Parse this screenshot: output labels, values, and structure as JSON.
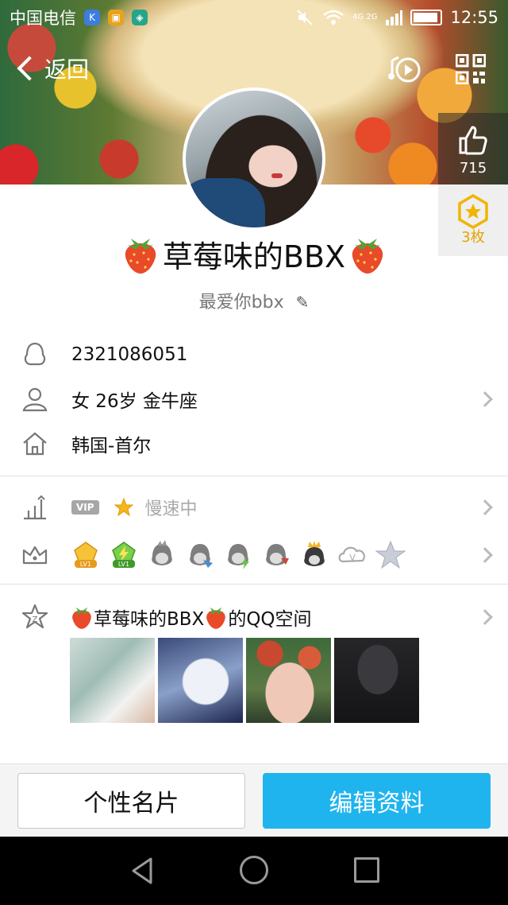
{
  "status_bar": {
    "carrier": "中国电信",
    "network": "4G 2G",
    "time": "12:55"
  },
  "nav": {
    "back_label": "返回"
  },
  "likes": {
    "count": "715"
  },
  "badges": {
    "count": "3枚"
  },
  "profile": {
    "nickname": "草莓味的BBX",
    "signature": "最爱你bbx"
  },
  "info": {
    "qq_number": "2321086051",
    "basic": "女  26岁  金牛座",
    "location": "韩国-首尔"
  },
  "vip": {
    "tag": "VIP",
    "status": "慢速中"
  },
  "medals": [
    {
      "name": "LV1"
    },
    {
      "name": "LV1"
    }
  ],
  "qzone": {
    "title": "的QQ空间",
    "owner": "草莓味的BBX"
  },
  "buttons": {
    "card": "个性名片",
    "edit": "编辑资料"
  },
  "colors": {
    "primary": "#1fb4ee",
    "like_bg": "#3a3a3a",
    "badge": "#e6a300"
  }
}
